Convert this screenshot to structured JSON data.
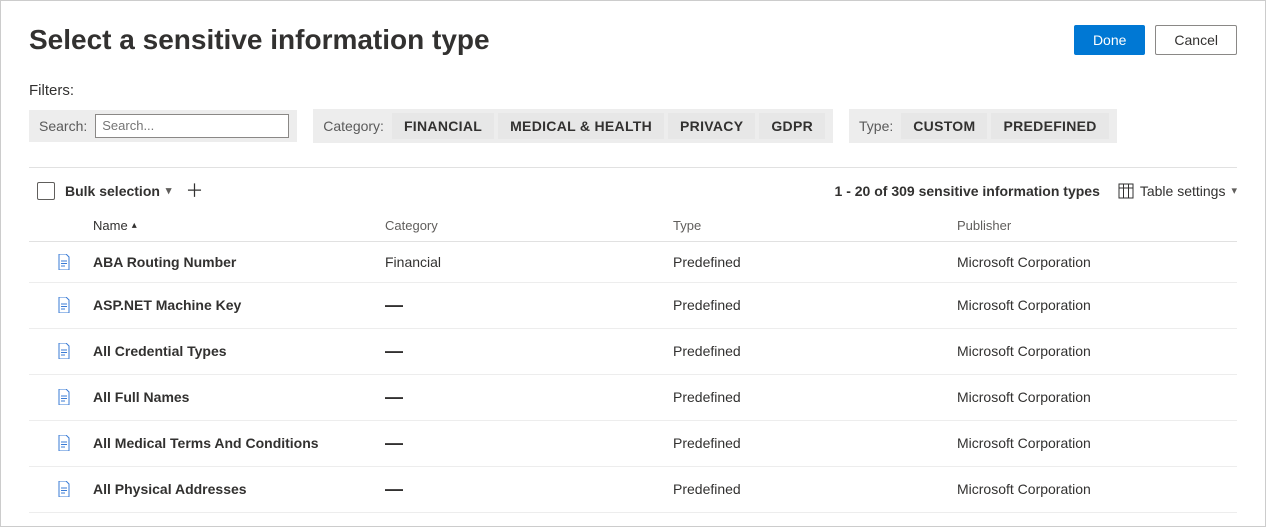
{
  "header": {
    "title": "Select a sensitive information type",
    "done": "Done",
    "cancel": "Cancel"
  },
  "filters": {
    "label": "Filters:",
    "search_label": "Search:",
    "search_placeholder": "Search...",
    "category_label": "Category:",
    "category_options": [
      "FINANCIAL",
      "MEDICAL & HEALTH",
      "PRIVACY",
      "GDPR"
    ],
    "type_label": "Type:",
    "type_options": [
      "CUSTOM",
      "PREDEFINED"
    ]
  },
  "toolbar": {
    "bulk_selection": "Bulk selection",
    "pagination_text": "1 - 20 of 309 sensitive information types",
    "table_settings": "Table settings"
  },
  "columns": {
    "name": "Name",
    "category": "Category",
    "type": "Type",
    "publisher": "Publisher"
  },
  "rows": [
    {
      "name": "ABA Routing Number",
      "category": "Financial",
      "type": "Predefined",
      "publisher": "Microsoft Corporation"
    },
    {
      "name": "ASP.NET Machine Key",
      "category": "—",
      "type": "Predefined",
      "publisher": "Microsoft Corporation"
    },
    {
      "name": "All Credential Types",
      "category": "—",
      "type": "Predefined",
      "publisher": "Microsoft Corporation"
    },
    {
      "name": "All Full Names",
      "category": "—",
      "type": "Predefined",
      "publisher": "Microsoft Corporation"
    },
    {
      "name": "All Medical Terms And Conditions",
      "category": "—",
      "type": "Predefined",
      "publisher": "Microsoft Corporation"
    },
    {
      "name": "All Physical Addresses",
      "category": "—",
      "type": "Predefined",
      "publisher": "Microsoft Corporation"
    }
  ]
}
